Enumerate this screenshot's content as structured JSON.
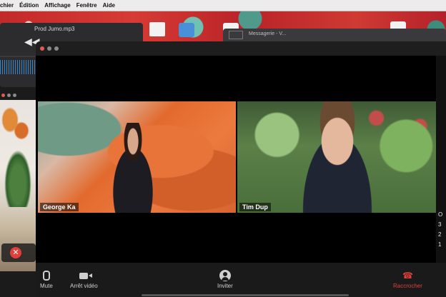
{
  "menubar": {
    "items": [
      "chier",
      "Édition",
      "Affichage",
      "Fenêtre",
      "Aide"
    ]
  },
  "audio_app": {
    "title": "Prod Jumo.mp3",
    "rewind_icon": "rewind-icon"
  },
  "messagerie": {
    "title": "Messagerie - V..."
  },
  "call": {
    "participants": [
      {
        "name": "George Ka"
      },
      {
        "name": "Tim Dup"
      }
    ],
    "toolbar": {
      "mute_label": "Mute",
      "video_label": "Arrêt vidéo",
      "invite_label": "Inviter",
      "hangup_label": "Raccrocher"
    },
    "right_panel_chars": [
      "O",
      "3",
      "2",
      "1"
    ]
  },
  "colors": {
    "hangup": "#e0403a",
    "wallpaper_red": "#c22a2a",
    "audio_wave": "#3a8fd6"
  }
}
